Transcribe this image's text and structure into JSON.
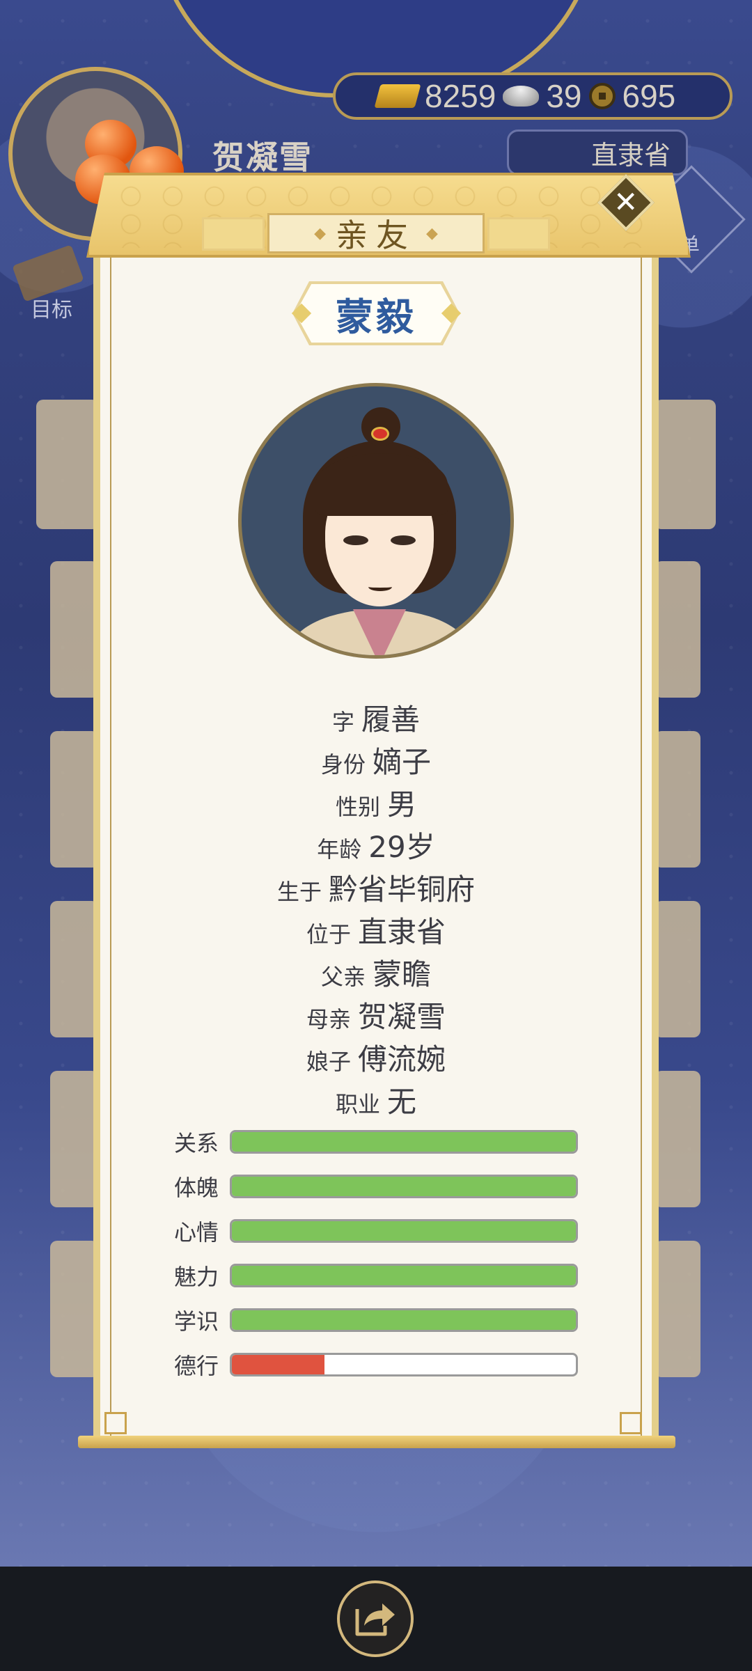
{
  "header": {
    "player_name": "贺凝雪",
    "currency": {
      "gold": "8259",
      "silver": "39",
      "coins": "695"
    },
    "location": "直隶省",
    "menu_label": "菜单",
    "goal_label": "目标"
  },
  "dialog": {
    "title": "亲友",
    "close_label": "✕",
    "character_name": "蒙毅",
    "info": [
      {
        "label": "字",
        "value": "履善"
      },
      {
        "label": "身份",
        "value": "嫡子"
      },
      {
        "label": "性别",
        "value": "男"
      },
      {
        "label": "年龄",
        "value": "29岁"
      },
      {
        "label": "生于",
        "value": "黔省毕铜府"
      },
      {
        "label": "位于",
        "value": "直隶省"
      },
      {
        "label": "父亲",
        "value": "蒙瞻"
      },
      {
        "label": "母亲",
        "value": "贺凝雪"
      },
      {
        "label": "娘子",
        "value": "傅流婉"
      },
      {
        "label": "职业",
        "value": "无"
      }
    ],
    "stats": [
      {
        "label": "关系",
        "fraction": 1.0,
        "color": "#7ec45a"
      },
      {
        "label": "体魄",
        "fraction": 1.0,
        "color": "#7ec45a"
      },
      {
        "label": "心情",
        "fraction": 1.0,
        "color": "#7ec45a"
      },
      {
        "label": "魅力",
        "fraction": 1.0,
        "color": "#7ec45a"
      },
      {
        "label": "学识",
        "fraction": 1.0,
        "color": "#7ec45a"
      },
      {
        "label": "德行",
        "fraction": 0.27,
        "color": "#e0533f"
      }
    ]
  },
  "colors": {
    "accent_gold": "#c9a24c",
    "name_blue": "#2f5b9e",
    "bar_green": "#7ec45a",
    "bar_red": "#e0533f"
  }
}
